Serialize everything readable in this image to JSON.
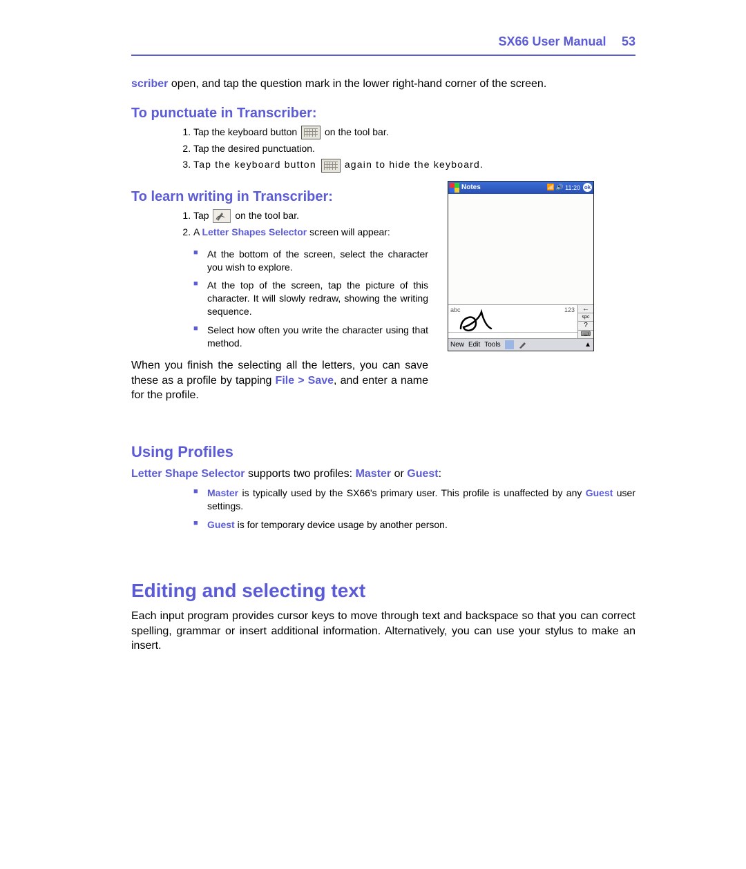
{
  "header": {
    "title": "SX66 User Manual",
    "page": "53"
  },
  "intro": {
    "scriber": "scriber",
    "rest": " open, and tap the question mark in the lower right-hand corner of the screen."
  },
  "sec_punctuate": {
    "title": "To punctuate in Transcriber:",
    "items": {
      "1a": "Tap the keyboard button ",
      "1b": " on the tool bar.",
      "2": "Tap the desired punctuation.",
      "3a": "Tap the keyboard button ",
      "3b": " again to hide the keyboard."
    }
  },
  "sec_learn": {
    "title": "To learn writing in Transcriber:",
    "items": {
      "1a": "Tap ",
      "1b": " on the tool bar.",
      "2a": "A ",
      "2b": "Letter Shapes Selector",
      "2c": " screen will appear:"
    },
    "bullets": {
      "a": "At the bottom of the screen, select the character you wish to explore.",
      "b": "At the top of the screen, tap the picture of this character. It will slowly redraw, showing the writing sequence.",
      "c": "Select how often you write the character using that method."
    },
    "finish_a": "When you finish the selecting all the letters, you can save these as a profile by tapping ",
    "finish_b": "File > Save",
    "finish_c": ", and enter a name for the profile."
  },
  "sec_profiles": {
    "title": "Using Profiles",
    "intro_a": "Letter Shape Selector",
    "intro_b": " supports two profiles: ",
    "intro_c": "Master",
    "intro_d": " or ",
    "intro_e": "Guest",
    "intro_f": ":",
    "bullets": {
      "m1": "Master",
      "m2": " is typically used by the SX66's primary user. This profile is unaffected by any ",
      "m3": "Guest",
      "m4": " user settings.",
      "g1": "Guest",
      "g2": " is for temporary device usage by another person."
    }
  },
  "sec_editing": {
    "title": "Editing and selecting text",
    "para": "Each input program provides cursor keys to move through text and backspace so that you can correct spelling, grammar or insert additional information. Alternatively, you can use your stylus to make an insert."
  },
  "shot": {
    "app": "Notes",
    "time": "11:20",
    "ok": "ok",
    "abc": "abc",
    "n123": "123",
    "bottom": {
      "new": "New",
      "edit": "Edit",
      "tools": "Tools"
    },
    "side": {
      "bs": "←",
      "spc": "spc",
      "help": "?",
      "kbd": "⌨"
    }
  }
}
